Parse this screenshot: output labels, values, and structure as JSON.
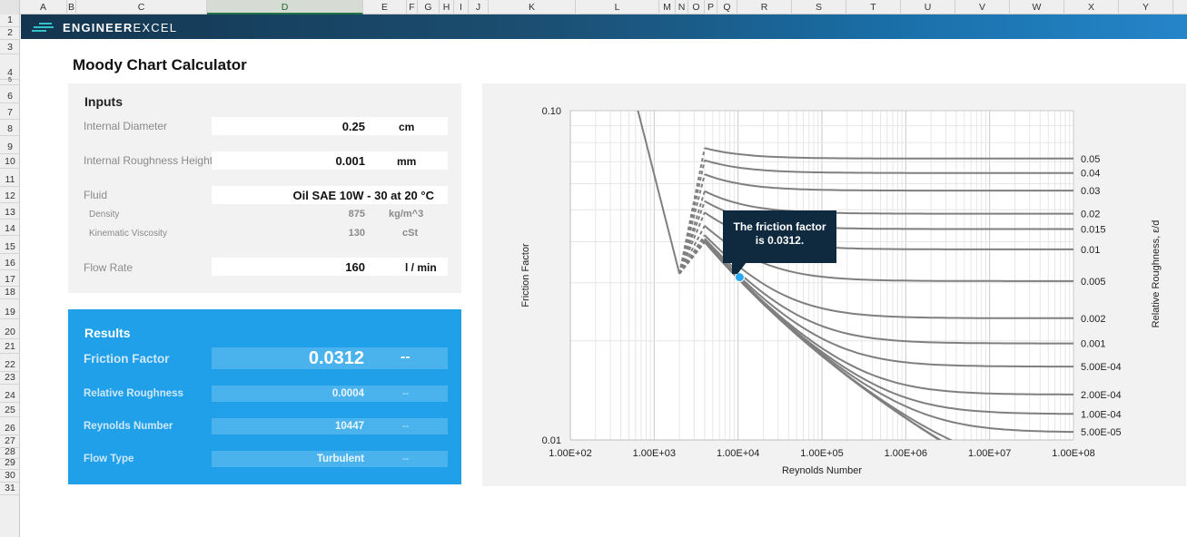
{
  "spreadsheet": {
    "columns": [
      "A",
      "B",
      "C",
      "D",
      "E",
      "F",
      "G",
      "H",
      "I",
      "J",
      "K",
      "L",
      "M",
      "N",
      "O",
      "P",
      "Q",
      "R",
      "S",
      "T",
      "U",
      "V",
      "W",
      "X",
      "Y"
    ],
    "selected_column": "D",
    "rows": [
      "1",
      "2",
      "3",
      "4",
      "5",
      "6",
      "7",
      "8",
      "9",
      "10",
      "11",
      "12",
      "13",
      "14",
      "15",
      "16",
      "17",
      "18",
      "19",
      "20",
      "21",
      "22",
      "23",
      "24",
      "25",
      "26",
      "27",
      "28",
      "29",
      "30",
      "31"
    ]
  },
  "brand": {
    "name_bold": "ENGINEER",
    "name_light": "EXCEL",
    "banner_color_start": "#14354f",
    "banner_color_end": "#2585c9",
    "logo_accent": "#33c3c6"
  },
  "page": {
    "title": "Moody Chart Calculator"
  },
  "inputs": {
    "title": "Inputs",
    "internal_diameter": {
      "label": "Internal Diameter",
      "value": "0.25",
      "unit": "cm"
    },
    "roughness_height": {
      "label": "Internal Roughness Height",
      "value": "0.001",
      "unit": "mm"
    },
    "fluid": {
      "label": "Fluid",
      "value": "Oil SAE 10W - 30 at 20 °C"
    },
    "density": {
      "label": "Density",
      "value": "875",
      "unit": "kg/m^3"
    },
    "viscosity": {
      "label": "Kinematic Viscosity",
      "value": "130",
      "unit": "cSt"
    },
    "flow_rate": {
      "label": "Flow Rate",
      "value": "160",
      "unit": "l  /  min"
    }
  },
  "results": {
    "title": "Results",
    "accent_color": "#1fa0e9",
    "friction_factor": {
      "label": "Friction Factor",
      "value": "0.0312",
      "unit": "--"
    },
    "relative_roughness": {
      "label": "Relative Roughness",
      "value": "0.0004",
      "unit": "--"
    },
    "reynolds_number": {
      "label": "Reynolds Number",
      "value": "10447",
      "unit": "--"
    },
    "flow_type": {
      "label": "Flow Type",
      "value": "Turbulent",
      "unit": "--"
    }
  },
  "chart": {
    "callout_line1": "The friction factor",
    "callout_line2": "is 0.0312.",
    "point_color": "#2aa8f2"
  },
  "chart_data": {
    "type": "line",
    "xlabel": "Reynolds Number",
    "ylabel": "Friction Factor",
    "y2label": "Relative Roughness, ε/d",
    "x_scale": "log",
    "y_scale": "log",
    "xlim": [
      100,
      100000000
    ],
    "ylim": [
      0.01,
      0.1
    ],
    "x_ticks": [
      "1.00E+02",
      "1.00E+03",
      "1.00E+04",
      "1.00E+05",
      "1.00E+06",
      "1.00E+07",
      "1.00E+08"
    ],
    "y_ticks": [
      "0.10",
      "0.01"
    ],
    "grid": true,
    "roughness_series": [
      {
        "label": "0.05",
        "value": 0.05
      },
      {
        "label": "0.04",
        "value": 0.04
      },
      {
        "label": "0.03",
        "value": 0.03
      },
      {
        "label": "0.02",
        "value": 0.02
      },
      {
        "label": "0.015",
        "value": 0.015
      },
      {
        "label": "0.01",
        "value": 0.01
      },
      {
        "label": "0.005",
        "value": 0.005
      },
      {
        "label": "0.002",
        "value": 0.002
      },
      {
        "label": "0.001",
        "value": 0.001
      },
      {
        "label": "5.00E-04",
        "value": 0.0005
      },
      {
        "label": "2.00E-04",
        "value": 0.0002
      },
      {
        "label": "1.00E-04",
        "value": 0.0001
      },
      {
        "label": "5.00E-05",
        "value": 5e-05
      },
      {
        "label": "",
        "value": 1e-05
      },
      {
        "label": "",
        "value": 1e-06
      },
      {
        "label": "",
        "value": 0
      }
    ],
    "laminar": {
      "formula": "f = 64/Re",
      "re_range": [
        100,
        2000
      ]
    },
    "transition": {
      "re_range": [
        2000,
        4000
      ]
    },
    "operating_point": {
      "re": 10447,
      "f": 0.0312
    }
  }
}
